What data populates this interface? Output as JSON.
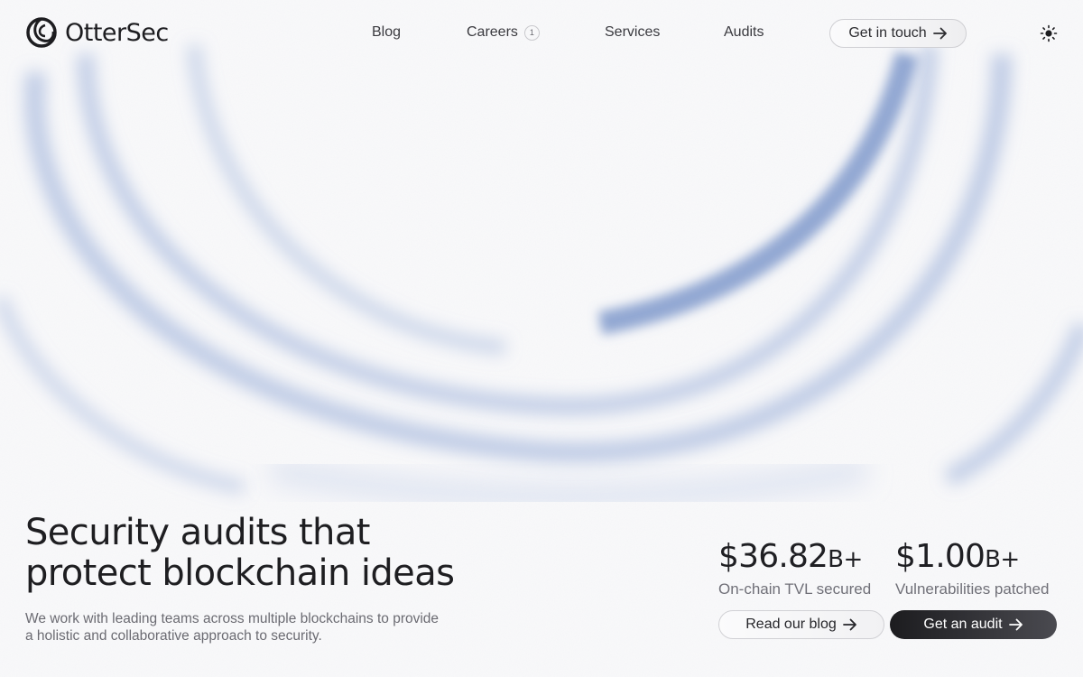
{
  "brand": {
    "name": "OtterSec",
    "logo_icon": "ottersec-logo-icon"
  },
  "nav": {
    "items": [
      {
        "label": "Blog"
      },
      {
        "label": "Careers",
        "badge": "1"
      },
      {
        "label": "Services"
      },
      {
        "label": "Audits"
      }
    ],
    "cta_label": "Get in touch",
    "theme_icon": "sun-icon"
  },
  "hero": {
    "title_line1": "Security audits that",
    "title_line2": "protect blockchain ideas",
    "subtitle": "We work with leading teams across multiple blockchains to provide a holistic and collaborative approach to security."
  },
  "stats": [
    {
      "value": "$36.82",
      "suffix": "B+",
      "label": "On-chain TVL secured"
    },
    {
      "value": "$1.00",
      "suffix": "B+",
      "label": "Vulnerabilities patched"
    }
  ],
  "actions": {
    "blog_label": "Read our blog",
    "audit_label": "Get an audit"
  },
  "colors": {
    "background": "#f9f9fa",
    "accent_wave": "#7f99cc",
    "text_primary": "#1e1e21",
    "text_secondary": "#6b6b72",
    "dark_button": "#1c1c1f"
  }
}
